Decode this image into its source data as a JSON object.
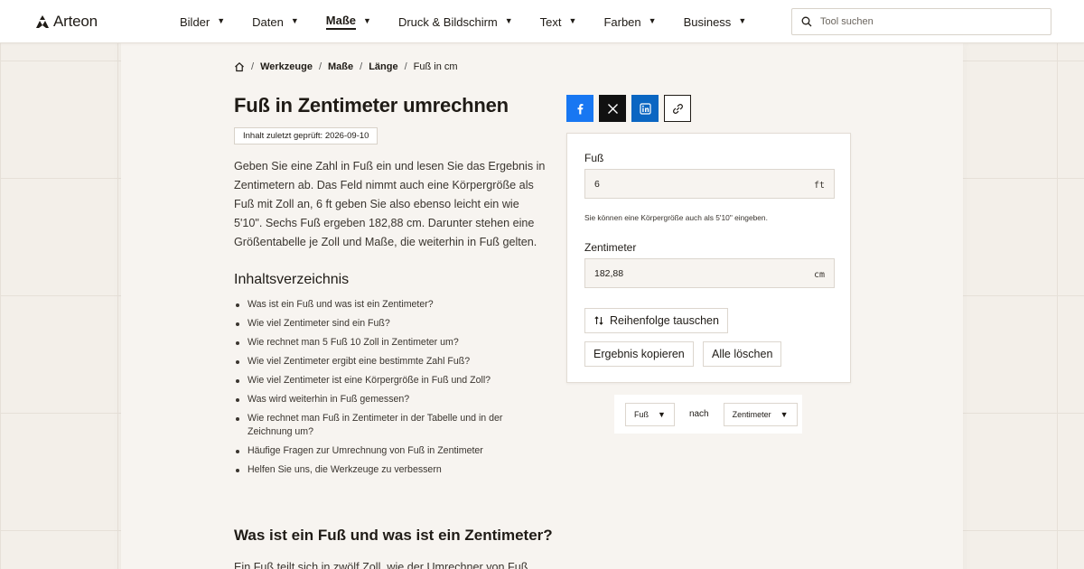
{
  "brand": {
    "name": "Arteon"
  },
  "nav": {
    "items": [
      {
        "label": "Bilder"
      },
      {
        "label": "Daten"
      },
      {
        "label": "Maße",
        "active": true
      },
      {
        "label": "Druck & Bildschirm"
      },
      {
        "label": "Text"
      },
      {
        "label": "Farben"
      },
      {
        "label": "Business"
      }
    ]
  },
  "search": {
    "placeholder": "Tool suchen"
  },
  "breadcrumb": [
    "Werkzeuge",
    "Maße",
    "Länge",
    "Fuß in cm"
  ],
  "page": {
    "title": "Fuß in Zentimeter umrechnen",
    "badge": "Inhalt zuletzt geprüft: 2026-09-10",
    "intro": "Geben Sie eine Zahl in Fuß ein und lesen Sie das Ergebnis in Zentimetern ab. Das Feld nimmt auch eine Körpergröße als Fuß mit Zoll an, 6 ft geben Sie also ebenso leicht ein wie 5'10\". Sechs Fuß ergeben 182,88 cm. Darunter stehen eine Größentabelle je Zoll und Maße, die weiterhin in Fuß gelten.",
    "toc_title": "Inhaltsverzeichnis",
    "toc": [
      "Was ist ein Fuß und was ist ein Zentimeter?",
      "Wie viel Zentimeter sind ein Fuß?",
      "Wie rechnet man 5 Fuß 10 Zoll in Zentimeter um?",
      "Wie viel Zentimeter ergibt eine bestimmte Zahl Fuß?",
      "Wie viel Zentimeter ist eine Körpergröße in Fuß und Zoll?",
      "Was wird weiterhin in Fuß gemessen?",
      "Wie rechnet man Fuß in Zentimeter in der Tabelle und in der Zeichnung um?",
      "Häufige Fragen zur Umrechnung von Fuß in Zentimeter",
      "Helfen Sie uns, die Werkzeuge zu verbessern"
    ],
    "section_title": "Was ist ein Fuß und was ist ein Zentimeter?",
    "section_text": "Ein Fuß teilt sich in zwölf Zoll, wie der Umrechner von Fuß"
  },
  "converter": {
    "from_label": "Fuß",
    "from_value": "6",
    "from_unit": "ft",
    "hint": "Sie können eine Körpergröße auch als 5'10\" eingeben.",
    "to_label": "Zentimeter",
    "to_value": "182,88",
    "to_unit": "cm",
    "swap_label": "Reihenfolge tauschen",
    "copy_label": "Ergebnis kopieren",
    "clear_label": "Alle löschen"
  },
  "unit_selector": {
    "from": "Fuß",
    "separator": "nach",
    "to": "Zentimeter"
  },
  "icons": {
    "home": "home-icon",
    "search": "search-icon",
    "facebook": "facebook-icon",
    "x": "x-icon",
    "linkedin": "linkedin-icon",
    "link": "link-icon",
    "swap": "swap-icon"
  },
  "colors": {
    "facebook": "#1877f2",
    "x": "#111111",
    "linkedin": "#0a66c2",
    "background": "#f3efe9",
    "text": "#1f1b16"
  }
}
